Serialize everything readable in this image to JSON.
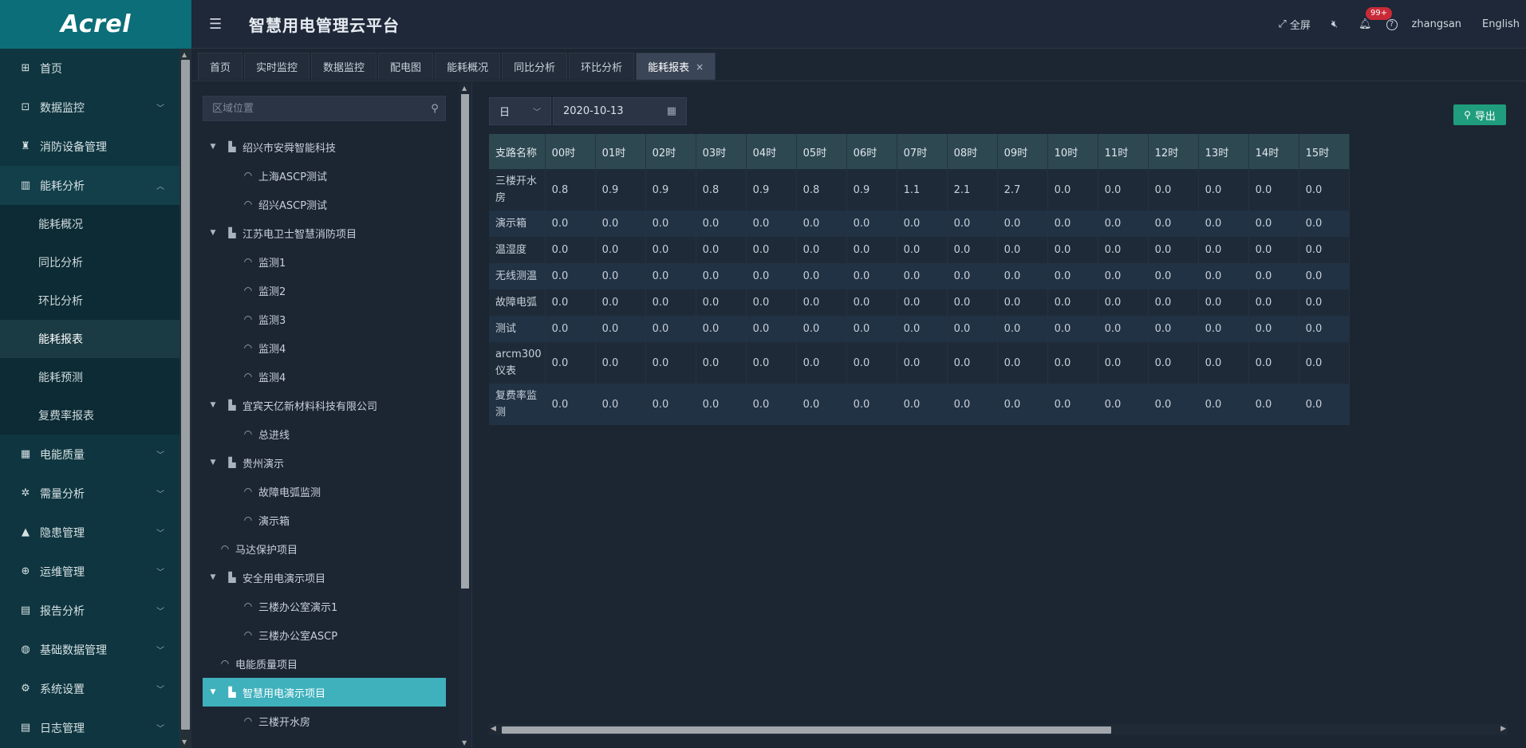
{
  "brand": {
    "logo": "Acrel"
  },
  "header": {
    "title": "智慧用电管理云平台",
    "fullscreen_label": "全屏",
    "notification_badge": "99+",
    "username": "zhangsan",
    "language": "English"
  },
  "sidebar": {
    "items": [
      {
        "label": "首页",
        "icon": "home-icon",
        "glyph": "⊞"
      },
      {
        "label": "数据监控",
        "icon": "monitor-icon",
        "glyph": "⊡"
      },
      {
        "label": "消防设备管理",
        "icon": "fire-extinguisher-icon",
        "glyph": "♜"
      },
      {
        "label": "能耗分析",
        "icon": "bar-chart-icon",
        "glyph": "▥"
      },
      {
        "label": "电能质量",
        "icon": "calendar-icon",
        "glyph": "▦"
      },
      {
        "label": "需量分析",
        "icon": "nodes-icon",
        "glyph": "✲"
      },
      {
        "label": "隐患管理",
        "icon": "warning-icon",
        "glyph": "▲"
      },
      {
        "label": "运维管理",
        "icon": "globe-icon",
        "glyph": "⊕"
      },
      {
        "label": "报告分析",
        "icon": "report-icon",
        "glyph": "▤"
      },
      {
        "label": "基础数据管理",
        "icon": "database-icon",
        "glyph": "◍"
      },
      {
        "label": "系统设置",
        "icon": "settings-icon",
        "glyph": "⚙"
      },
      {
        "label": "日志管理",
        "icon": "log-icon",
        "glyph": "▤"
      }
    ],
    "energy_submenu": [
      "能耗概况",
      "同比分析",
      "环比分析",
      "能耗报表",
      "能耗预测",
      "复费率报表"
    ]
  },
  "tabs": [
    {
      "label": "首页"
    },
    {
      "label": "实时监控"
    },
    {
      "label": "数据监控"
    },
    {
      "label": "配电图"
    },
    {
      "label": "能耗概况"
    },
    {
      "label": "同比分析"
    },
    {
      "label": "环比分析"
    },
    {
      "label": "能耗报表",
      "active": true
    }
  ],
  "tree": {
    "search_placeholder": "区域位置",
    "nodes": [
      {
        "label": "绍兴市安舜智能科技",
        "level": 0,
        "type": "project"
      },
      {
        "label": "上海ASCP测试",
        "level": 1,
        "type": "meter"
      },
      {
        "label": "绍兴ASCP测试",
        "level": 1,
        "type": "meter"
      },
      {
        "label": "江苏电卫士智慧消防项目",
        "level": 0,
        "type": "project"
      },
      {
        "label": "监测1",
        "level": 1,
        "type": "meter"
      },
      {
        "label": "监测2",
        "level": 1,
        "type": "meter"
      },
      {
        "label": "监测3",
        "level": 1,
        "type": "meter"
      },
      {
        "label": "监测4",
        "level": 1,
        "type": "meter"
      },
      {
        "label": "监测4",
        "level": 1,
        "type": "meter"
      },
      {
        "label": "宜宾天亿新材料科技有限公司",
        "level": 0,
        "type": "project"
      },
      {
        "label": "总进线",
        "level": 1,
        "type": "meter"
      },
      {
        "label": "贵州演示",
        "level": 0,
        "type": "project"
      },
      {
        "label": "故障电弧监测",
        "level": 1,
        "type": "meter"
      },
      {
        "label": "演示箱",
        "level": 1,
        "type": "meter"
      },
      {
        "label": "马达保护项目",
        "level": 0,
        "type": "leaf"
      },
      {
        "label": "安全用电演示项目",
        "level": 0,
        "type": "project"
      },
      {
        "label": "三楼办公室演示1",
        "level": 1,
        "type": "meter"
      },
      {
        "label": "三楼办公室ASCP",
        "level": 1,
        "type": "meter"
      },
      {
        "label": "电能质量项目",
        "level": 0,
        "type": "leaf"
      },
      {
        "label": "智慧用电演示项目",
        "level": 0,
        "type": "project",
        "selected": true
      },
      {
        "label": "三楼开水房",
        "level": 1,
        "type": "meter"
      }
    ]
  },
  "report": {
    "period": "日",
    "date": "2020-10-13",
    "export_label": "导出",
    "columns": [
      "支路名称",
      "00时",
      "01时",
      "02时",
      "03时",
      "04时",
      "05时",
      "06时",
      "07时",
      "08时",
      "09时",
      "10时",
      "11时",
      "12时",
      "13时",
      "14时",
      "15时"
    ],
    "rows": [
      {
        "name": "三楼开水房",
        "values": [
          "0.8",
          "0.9",
          "0.9",
          "0.8",
          "0.9",
          "0.8",
          "0.9",
          "1.1",
          "2.1",
          "2.7",
          "0.0",
          "0.0",
          "0.0",
          "0.0",
          "0.0",
          "0.0"
        ]
      },
      {
        "name": "演示箱",
        "values": [
          "0.0",
          "0.0",
          "0.0",
          "0.0",
          "0.0",
          "0.0",
          "0.0",
          "0.0",
          "0.0",
          "0.0",
          "0.0",
          "0.0",
          "0.0",
          "0.0",
          "0.0",
          "0.0"
        ]
      },
      {
        "name": "温湿度",
        "values": [
          "0.0",
          "0.0",
          "0.0",
          "0.0",
          "0.0",
          "0.0",
          "0.0",
          "0.0",
          "0.0",
          "0.0",
          "0.0",
          "0.0",
          "0.0",
          "0.0",
          "0.0",
          "0.0"
        ]
      },
      {
        "name": "无线测温",
        "values": [
          "0.0",
          "0.0",
          "0.0",
          "0.0",
          "0.0",
          "0.0",
          "0.0",
          "0.0",
          "0.0",
          "0.0",
          "0.0",
          "0.0",
          "0.0",
          "0.0",
          "0.0",
          "0.0"
        ]
      },
      {
        "name": "故障电弧",
        "values": [
          "0.0",
          "0.0",
          "0.0",
          "0.0",
          "0.0",
          "0.0",
          "0.0",
          "0.0",
          "0.0",
          "0.0",
          "0.0",
          "0.0",
          "0.0",
          "0.0",
          "0.0",
          "0.0"
        ]
      },
      {
        "name": "测试",
        "values": [
          "0.0",
          "0.0",
          "0.0",
          "0.0",
          "0.0",
          "0.0",
          "0.0",
          "0.0",
          "0.0",
          "0.0",
          "0.0",
          "0.0",
          "0.0",
          "0.0",
          "0.0",
          "0.0"
        ]
      },
      {
        "name": "arcm300仪表",
        "values": [
          "0.0",
          "0.0",
          "0.0",
          "0.0",
          "0.0",
          "0.0",
          "0.0",
          "0.0",
          "0.0",
          "0.0",
          "0.0",
          "0.0",
          "0.0",
          "0.0",
          "0.0",
          "0.0"
        ]
      },
      {
        "name": "复费率监测",
        "values": [
          "0.0",
          "0.0",
          "0.0",
          "0.0",
          "0.0",
          "0.0",
          "0.0",
          "0.0",
          "0.0",
          "0.0",
          "0.0",
          "0.0",
          "0.0",
          "0.0",
          "0.0",
          "0.0"
        ]
      }
    ]
  }
}
